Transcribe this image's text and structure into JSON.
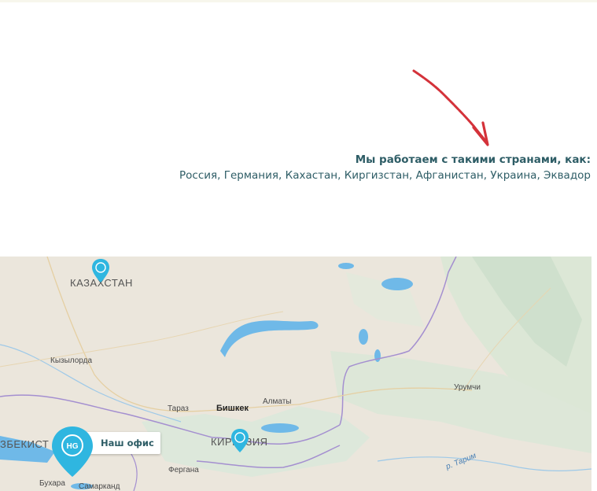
{
  "info": {
    "title": "Мы работаем с такими странами, как:",
    "countries": "Россия, Германия, Кахастан, Киргизстан, Афганистан, Украина, Эквадор"
  },
  "map": {
    "labels": {
      "kazakhstan": "КАЗАХСТАН",
      "kyzylorda": "Кызылорда",
      "taraz": "Тараз",
      "bishkek": "Бишкек",
      "almaty": "Алматы",
      "urumqi": "Урумчи",
      "river_tarim": "р. Тарим",
      "uzbekistan": "ЗБЕКИСТ",
      "kyrgyzstan": "КИРГИЗИЯ",
      "fergana": "Фергана",
      "bukhara": "Бухара",
      "samarkand": "Самарканд"
    },
    "office_label": "Наш офис",
    "pin_logo_text": "HG",
    "colors": {
      "pin": "#2fb6e0",
      "water": "#6fb9e8",
      "land": "#ebe6dc",
      "mountains": "#dbe6d8",
      "border": "#9a86c9",
      "arrow": "#d4323a"
    }
  }
}
